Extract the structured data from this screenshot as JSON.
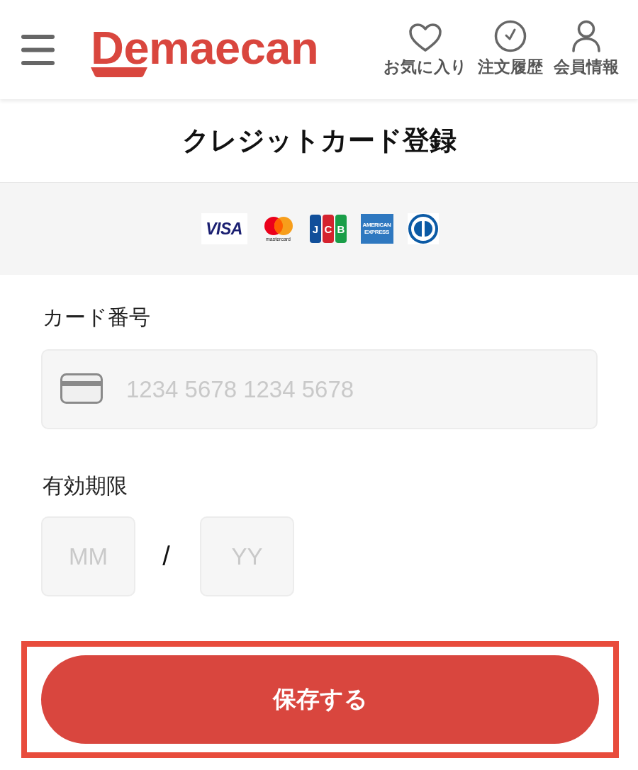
{
  "header": {
    "logo": "Demaecan",
    "nav": [
      {
        "kind": "favorites",
        "label": "お気に入り"
      },
      {
        "kind": "history",
        "label": "注文履歴"
      },
      {
        "kind": "account",
        "label": "会員情報"
      }
    ]
  },
  "page_title": "クレジットカード登録",
  "card_brands": [
    {
      "kind": "visa",
      "label": "VISA"
    },
    {
      "kind": "mastercard",
      "label": "mastercard"
    },
    {
      "kind": "jcb",
      "label": "JCB"
    },
    {
      "kind": "amex",
      "label": "AMERICAN EXPRESS"
    },
    {
      "kind": "diners"
    }
  ],
  "form": {
    "card_number": {
      "label": "カード番号",
      "placeholder": "1234 5678 1234 5678"
    },
    "expiry": {
      "label": "有効期限",
      "month": {
        "placeholder": "MM"
      },
      "separator": "/",
      "year": {
        "placeholder": "YY"
      }
    }
  },
  "save_button": {
    "label": "保存する",
    "highlighted": true
  }
}
